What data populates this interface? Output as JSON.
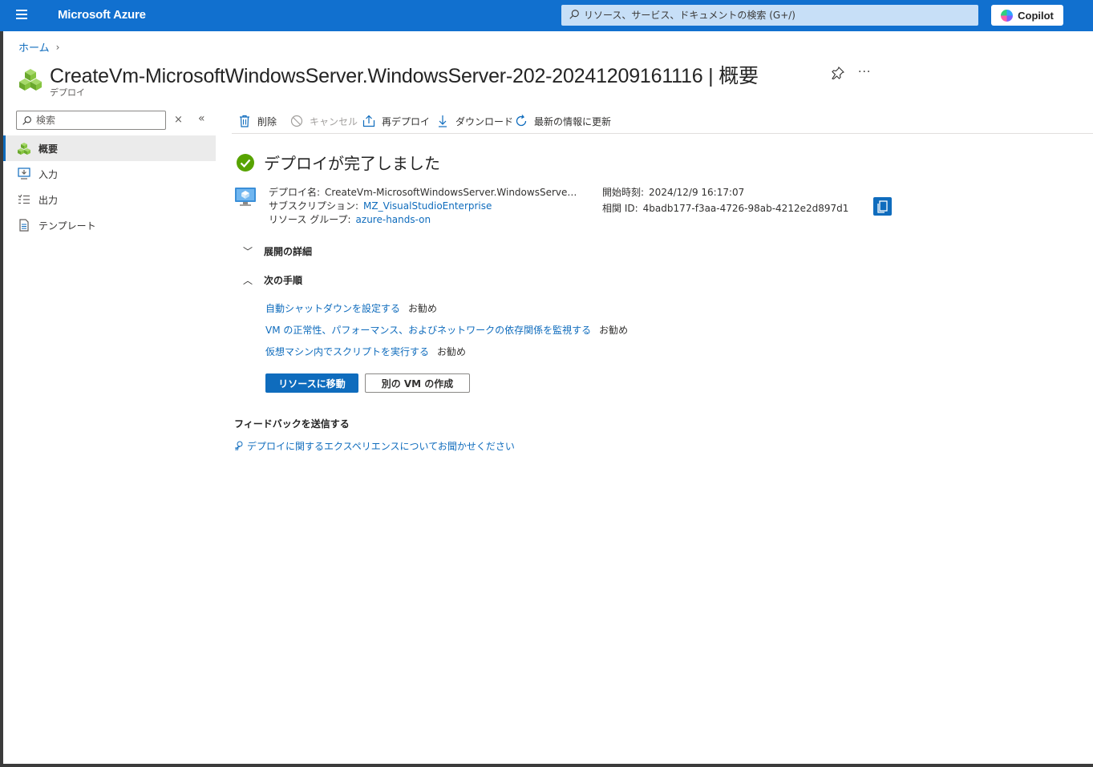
{
  "topbar": {
    "brand": "Microsoft Azure",
    "search_placeholder": "リソース、サービス、ドキュメントの検索 (G+/)",
    "copilot_label": "Copilot"
  },
  "breadcrumb": {
    "home": "ホーム"
  },
  "header": {
    "title": "CreateVm-MicrosoftWindowsServer.WindowsServer-202-20241209161116 | 概要",
    "subtitle": "デプロイ",
    "more": "···"
  },
  "sidebar": {
    "search_placeholder": "検索",
    "clear": "×",
    "collapse": "«",
    "items": [
      {
        "label": "概要",
        "icon": "deployment-icon",
        "active": true
      },
      {
        "label": "入力",
        "icon": "input-icon",
        "active": false
      },
      {
        "label": "出力",
        "icon": "output-icon",
        "active": false
      },
      {
        "label": "テンプレート",
        "icon": "template-icon",
        "active": false
      }
    ]
  },
  "toolbar": {
    "delete": "削除",
    "cancel": "キャンセル",
    "redeploy": "再デプロイ",
    "download": "ダウンロード",
    "refresh": "最新の情報に更新"
  },
  "status": {
    "title": "デプロイが完了しました",
    "color": "#57a300"
  },
  "details": {
    "deploy_name_label": "デプロイ名:",
    "deploy_name_value": "CreateVm-MicrosoftWindowsServer.WindowsServe…",
    "subscription_label": "サブスクリプション:",
    "subscription_value": "MZ_VisualStudioEnterprise",
    "resource_group_label": "リソース グループ:",
    "resource_group_value": "azure-hands-on",
    "start_time_label": "開始時刻:",
    "start_time_value": "2024/12/9 16:17:07",
    "correlation_label": "相関 ID:",
    "correlation_value": "4badb177-f3aa-4726-98ab-4212e2d897d1"
  },
  "sections": {
    "deployment_details": "展開の詳細",
    "next_steps": "次の手順"
  },
  "next_steps": [
    {
      "link": "自動シャットダウンを設定する",
      "tag": "お勧め"
    },
    {
      "link": "VM の正常性、パフォーマンス、およびネットワークの依存関係を監視する",
      "tag": "お勧め"
    },
    {
      "link": "仮想マシン内でスクリプトを実行する",
      "tag": "お勧め"
    }
  ],
  "buttons": {
    "go_to_resource": "リソースに移動",
    "create_another_vm": "別の VM の作成"
  },
  "feedback": {
    "title": "フィードバックを送信する",
    "link": "デプロイに関するエクスペリエンスについてお聞かせください"
  },
  "colors": {
    "topbar": "#1170cf",
    "accent": "#0f6cbd",
    "success": "#57a300"
  }
}
